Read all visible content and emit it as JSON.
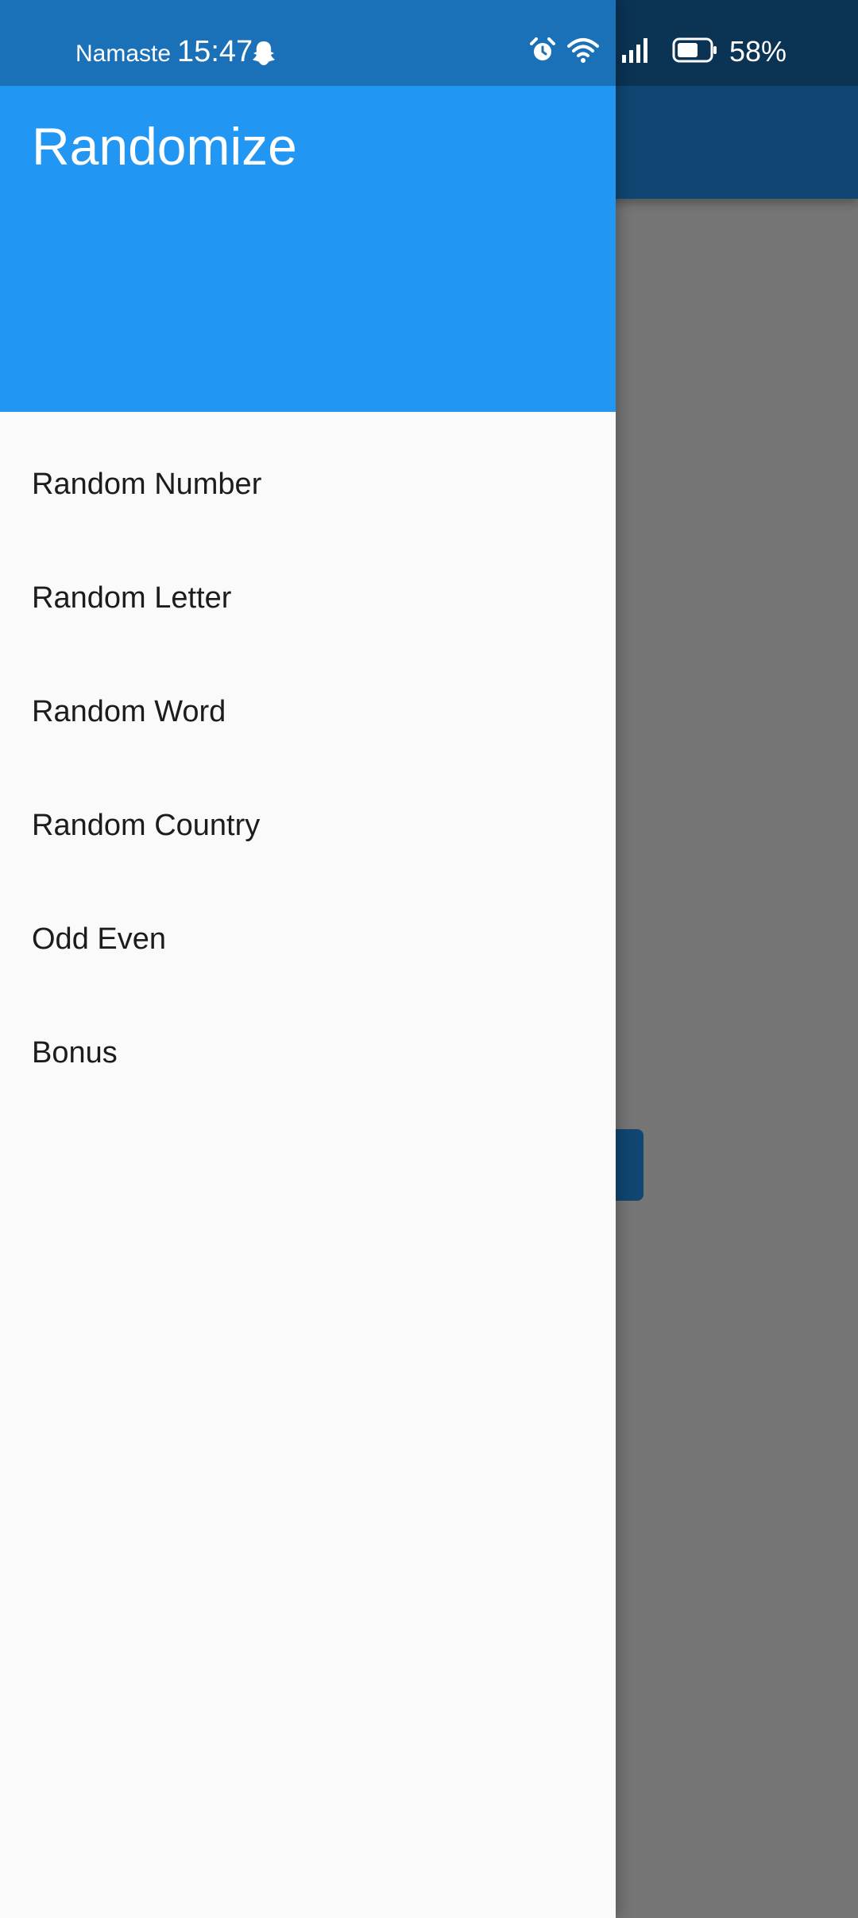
{
  "status_bar": {
    "carrier": "Namaste",
    "time": "15:47",
    "battery": "58%",
    "icons": [
      "snapchat-ghost-icon",
      "alarm-icon",
      "wifi-icon",
      "signal-icon",
      "battery-icon"
    ]
  },
  "drawer": {
    "title": "Randomize",
    "items": [
      {
        "label": "Random Number"
      },
      {
        "label": "Random Letter"
      },
      {
        "label": "Random Word"
      },
      {
        "label": "Random Country"
      },
      {
        "label": "Odd Even"
      },
      {
        "label": "Bonus"
      }
    ]
  },
  "colors": {
    "drawer_header": "#2196f3",
    "drawer_status": "#1a71b8",
    "app_bar_dimmed": "#104671",
    "scrim": "#757575",
    "drawer_bg": "#fafafa"
  }
}
